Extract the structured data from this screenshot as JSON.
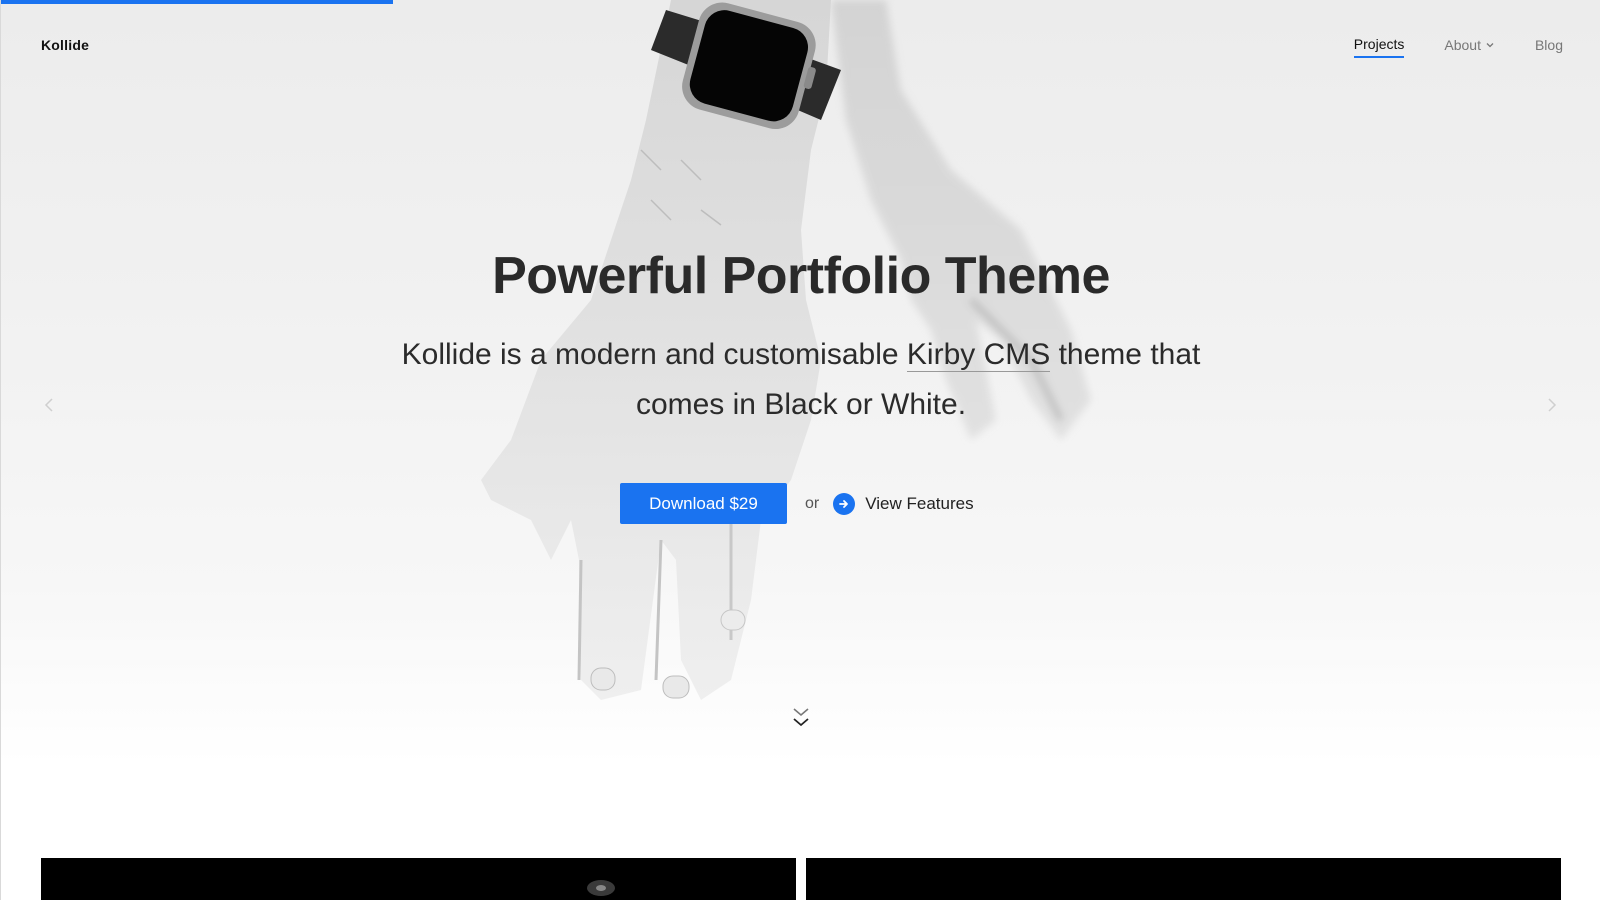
{
  "brand": {
    "name": "Kollide",
    "accent_color": "#1a73f0"
  },
  "page_progress": 0.245,
  "nav": {
    "items": [
      {
        "label": "Projects",
        "active": true
      },
      {
        "label": "About",
        "has_dropdown": true
      },
      {
        "label": "Blog"
      }
    ]
  },
  "hero": {
    "title": "Powerful Portfolio Theme",
    "subtitle_before": "Kollide is a modern and customisable ",
    "subtitle_link": "Kirby CMS",
    "subtitle_after": " theme that comes in Black or White.",
    "download_label": "Download $29",
    "or_text": "or",
    "features_label": "View Features",
    "icons": {
      "features": "arrow-right-circle-icon",
      "scroll": "double-chevron-down-icon",
      "prev": "chevron-left-icon",
      "next": "chevron-right-icon"
    }
  },
  "projects": {
    "items": [
      {
        "name": "project-card-1"
      },
      {
        "name": "project-card-2"
      }
    ]
  }
}
